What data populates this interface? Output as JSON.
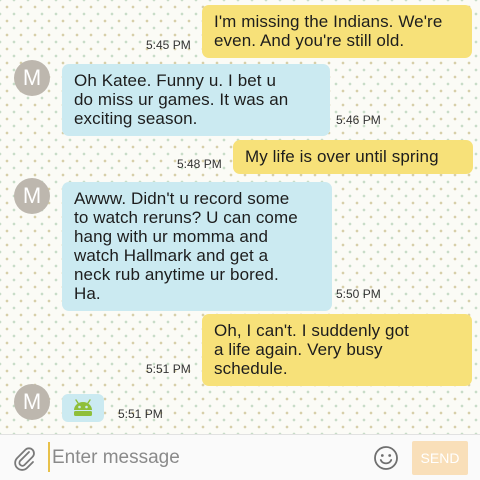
{
  "messages": [
    {
      "direction": "out",
      "lines": [
        "I'm missing the Indians. We're",
        "even. And you're still old."
      ],
      "time": "5:45 PM"
    },
    {
      "direction": "in",
      "avatar": "M",
      "lines": [
        "Oh Katee.  Funny u. I bet u",
        "do miss ur games. It was an",
        "exciting season."
      ],
      "time": "5:46 PM"
    },
    {
      "direction": "out",
      "lines": [
        "My life is over until spring"
      ],
      "time": "5:48 PM"
    },
    {
      "direction": "in",
      "avatar": "M",
      "lines": [
        "Awww. Didn't u record some",
        "to watch reruns? U can come",
        "hang with ur momma and",
        "watch Hallmark and get a",
        "neck rub anytime ur bored.",
        "Ha."
      ],
      "time": "5:50 PM"
    },
    {
      "direction": "out",
      "lines": [
        "Oh, I can't. I suddenly got",
        "a life again. Very busy",
        "schedule."
      ],
      "time": "5:51 PM"
    },
    {
      "direction": "in",
      "avatar": "M",
      "attachment_icon": "android-icon",
      "time": "5:51 PM"
    }
  ],
  "compose": {
    "placeholder": "Enter message",
    "send_label": "SEND"
  },
  "colors": {
    "outgoing_bubble": "#f7e179",
    "incoming_bubble": "#cbeaf1",
    "avatar": "#bdb7ae",
    "send_button": "#f9dfb9",
    "android_icon": "#8fbf3a"
  }
}
